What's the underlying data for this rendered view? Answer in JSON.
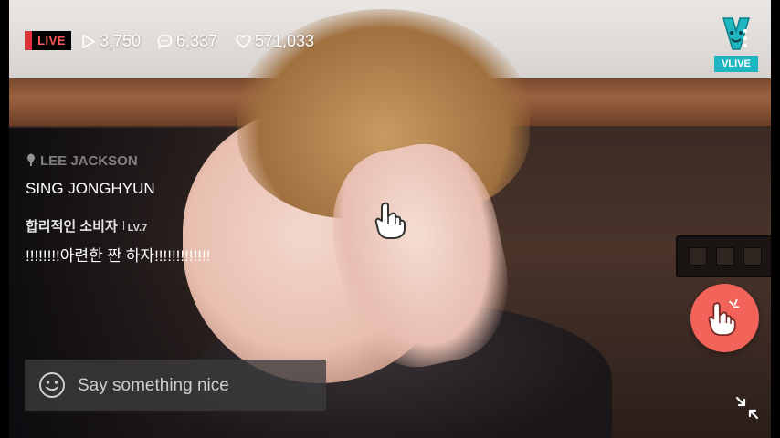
{
  "stream": {
    "live_label": "LIVE",
    "plays": "3,750",
    "comments": "6,337",
    "hearts": "571,033"
  },
  "logo": {
    "text": "VLIVE",
    "color": "#1fb6c2"
  },
  "chat": [
    {
      "name": "LEE JACKSON",
      "message": "SING JONGHYUN",
      "icon": "mic-icon"
    },
    {
      "name": "합리적인 소비자",
      "level": "LV.7",
      "message": "!!!!!!!!아련한 짠 하자!!!!!!!!!!!!!"
    }
  ],
  "input": {
    "placeholder": "Say something nice"
  },
  "colors": {
    "accent": "#f2635a",
    "live_red": "#e0313a"
  },
  "icons": {
    "play": "play-icon",
    "comment": "comment-icon",
    "heart": "heart-outline-icon",
    "more": "more-vertical-icon",
    "smile": "smile-icon",
    "finger_heart": "finger-heart-icon",
    "collapse": "collapse-icon"
  }
}
